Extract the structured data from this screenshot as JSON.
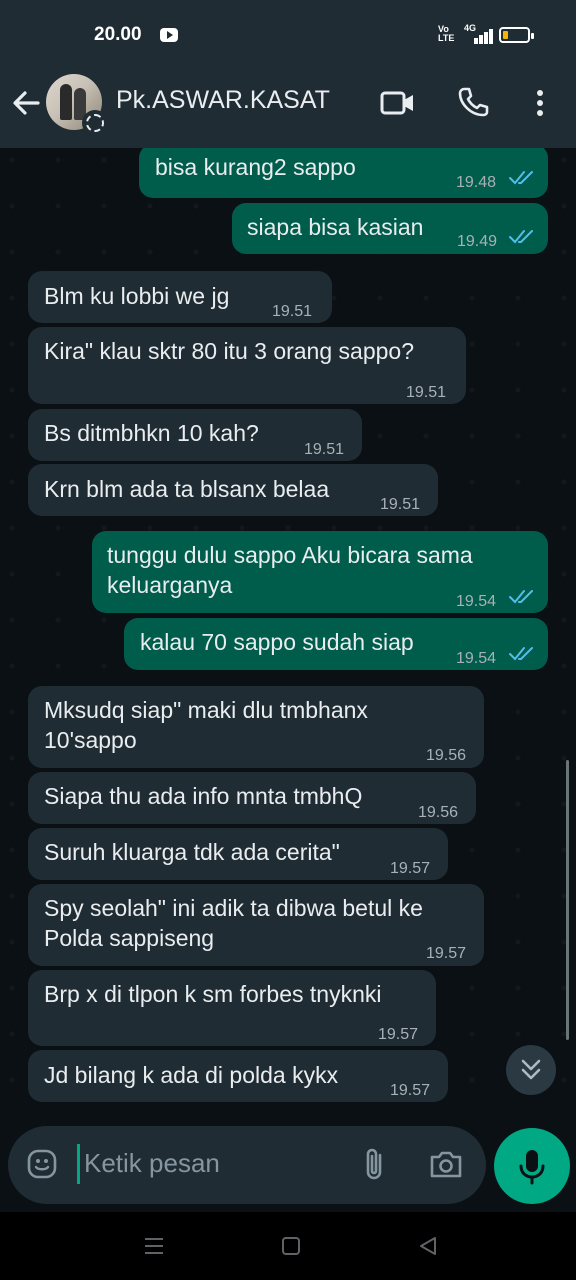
{
  "status_bar": {
    "time": "20.00",
    "volte": "Vo\nLTE",
    "network": "4G"
  },
  "header": {
    "contact_name": "Pk.ASWAR.KASAT"
  },
  "messages": [
    {
      "dir": "out",
      "text": "bisa kurang2 sappo",
      "time": "19.48",
      "read": true
    },
    {
      "dir": "out",
      "text": "siapa bisa kasian",
      "time": "19.49",
      "read": true
    },
    {
      "dir": "in",
      "text": "Blm ku lobbi we jg",
      "time": "19.51"
    },
    {
      "dir": "in",
      "text": "Kira\" klau sktr 80 itu 3 orang sappo?",
      "time": "19.51"
    },
    {
      "dir": "in",
      "text": "Bs ditmbhkn 10 kah?",
      "time": "19.51"
    },
    {
      "dir": "in",
      "text": "Krn blm ada ta blsanx belaa",
      "time": "19.51"
    },
    {
      "dir": "out",
      "text_line1": "tunggu dulu sappo Aku bicara sama",
      "text_line2": "keluarganya",
      "time": "19.54",
      "read": true
    },
    {
      "dir": "out",
      "text": "kalau 70 sappo sudah siap",
      "time": "19.54",
      "read": true
    },
    {
      "dir": "in",
      "text_line1": "Mksudq siap\" maki dlu tmbhanx",
      "text_line2": "10'sappo",
      "time": "19.56"
    },
    {
      "dir": "in",
      "text": "Siapa thu ada info mnta tmbhQ",
      "time": "19.56"
    },
    {
      "dir": "in",
      "text": "Suruh kluarga tdk ada cerita\"",
      "time": "19.57"
    },
    {
      "dir": "in",
      "text_line1": "Spy seolah\" ini adik ta dibwa betul ke",
      "text_line2": "Polda sappiseng",
      "time": "19.57"
    },
    {
      "dir": "in",
      "text": "Brp x di tlpon k sm forbes tnyknki",
      "time": "19.57"
    },
    {
      "dir": "in",
      "text": "Jd bilang k ada di polda kykx",
      "time": "19.57"
    }
  ],
  "composer": {
    "placeholder": "Ketik pesan"
  },
  "colors": {
    "header_bg": "#1f2c34",
    "chat_bg": "#0b1014",
    "outgoing_bubble": "#005c4b",
    "incoming_bubble": "#202c33",
    "accent": "#00a884",
    "read_ticks": "#53bdeb"
  },
  "icons": [
    "back-arrow-icon",
    "video-call-icon",
    "voice-call-icon",
    "more-options-icon",
    "emoji-icon",
    "attach-icon",
    "camera-icon",
    "mic-icon",
    "scroll-down-icon",
    "read-receipt-icon"
  ]
}
